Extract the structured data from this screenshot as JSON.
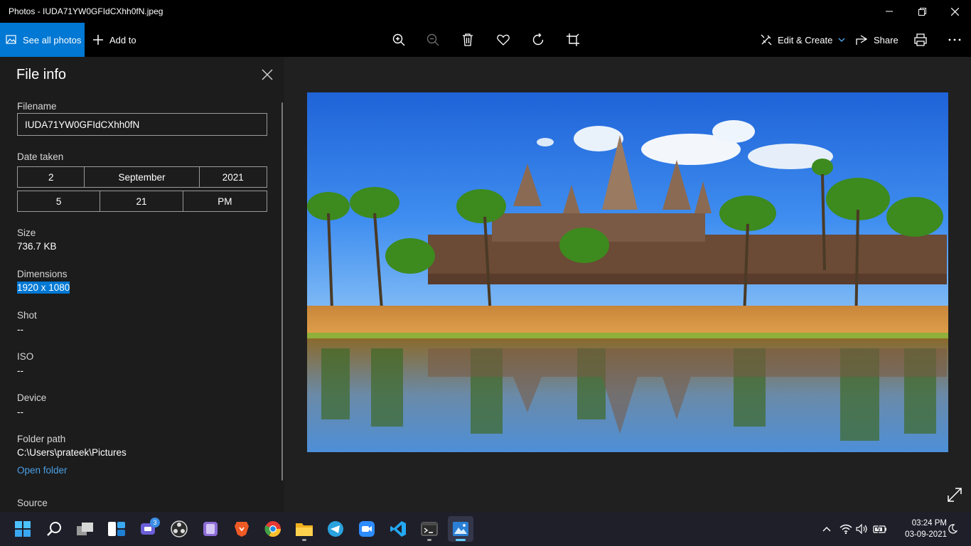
{
  "window": {
    "title": "Photos - IUDA71YW0GFIdCXhh0fN.jpeg"
  },
  "toolbar": {
    "see_all_photos": "See all photos",
    "add_to": "Add to",
    "edit_create": "Edit & Create",
    "share": "Share"
  },
  "file_info": {
    "title": "File info",
    "filename_label": "Filename",
    "filename_value": "IUDA71YW0GFIdCXhh0fN",
    "date_taken_label": "Date taken",
    "date": {
      "day": "2",
      "month": "September",
      "year": "2021"
    },
    "time": {
      "hour": "5",
      "minute": "21",
      "ampm": "PM"
    },
    "size_label": "Size",
    "size_value": "736.7 KB",
    "dimensions_label": "Dimensions",
    "dimensions_value": "1920 x 1080",
    "shot_label": "Shot",
    "shot_value": "--",
    "iso_label": "ISO",
    "iso_value": "--",
    "device_label": "Device",
    "device_value": "--",
    "folder_path_label": "Folder path",
    "folder_path_value": "C:\\Users\\prateek\\Pictures",
    "open_folder": "Open folder",
    "source_label": "Source"
  },
  "taskbar": {
    "chat_badge": "3",
    "time": "03:24 PM",
    "date": "03-09-2021"
  },
  "colors": {
    "accent": "#0078d4",
    "panel_bg": "#1c1c1c",
    "viewer_bg": "#202020",
    "link": "#4aa0e6"
  }
}
